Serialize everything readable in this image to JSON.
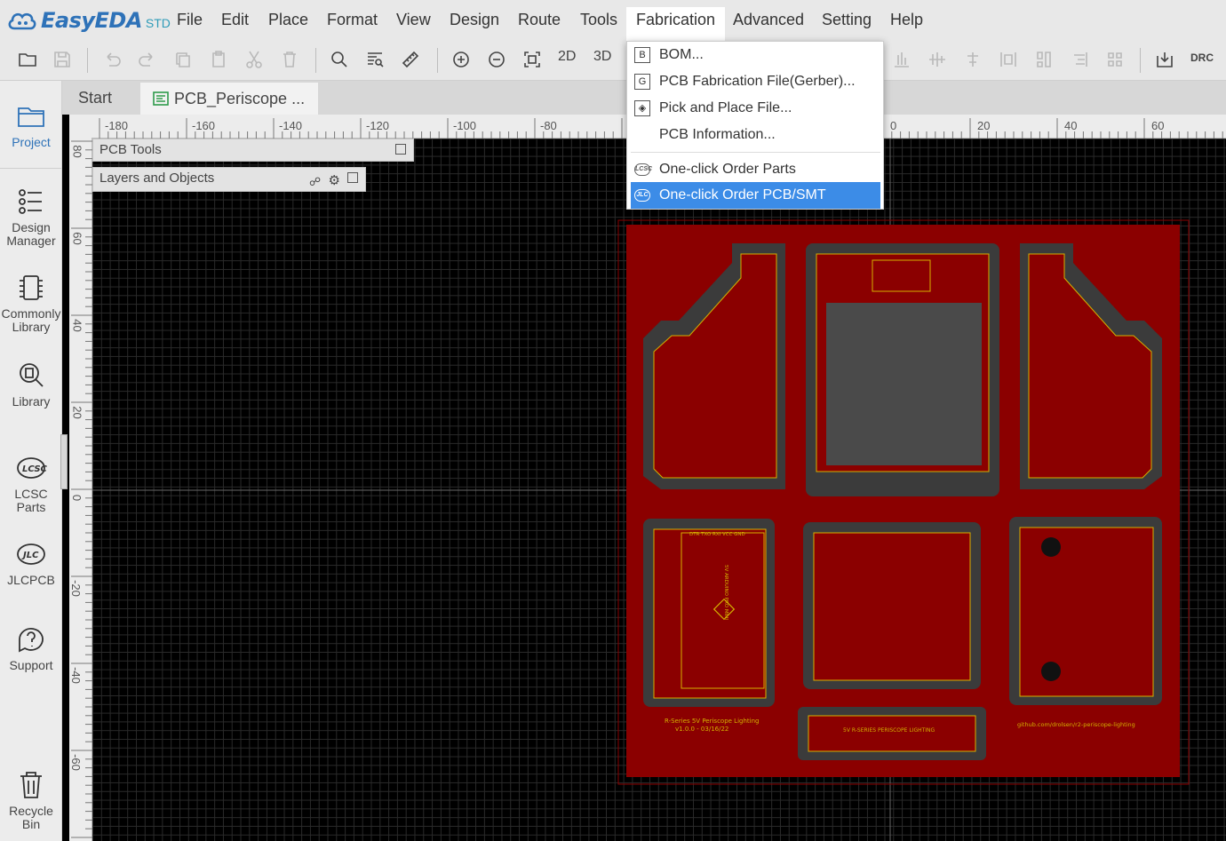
{
  "app": {
    "brand": "EasyEDA",
    "edition": "STD",
    "accent_color": "#2e72b8"
  },
  "menu": {
    "items": [
      "File",
      "Edit",
      "Place",
      "Format",
      "View",
      "Design",
      "Route",
      "Tools",
      "Fabrication",
      "Advanced",
      "Setting",
      "Help"
    ],
    "active": "Fabrication"
  },
  "toolbar": {
    "view_2d": "2D",
    "view_3d": "3D",
    "drc": "DRC"
  },
  "sidebar": {
    "items": [
      {
        "label": "Project",
        "icon": "folder-icon"
      },
      {
        "label": "Design\nManager",
        "icon": "design-manager-icon"
      },
      {
        "label": "Commonly\nLibrary",
        "icon": "chip-icon"
      },
      {
        "label": "Library",
        "icon": "library-search-icon"
      },
      {
        "label": "LCSC\nParts",
        "icon": "lcsc-logo-icon"
      },
      {
        "label": "JLCPCB",
        "icon": "jlc-logo-icon"
      },
      {
        "label": "Support",
        "icon": "help-icon"
      },
      {
        "label": "Recycle\nBin",
        "icon": "trash-icon"
      }
    ],
    "active": "Project"
  },
  "tabs": [
    {
      "label": "Start"
    },
    {
      "label": "PCB_Periscope ..."
    }
  ],
  "ruler": {
    "x_ticks": [
      "-180",
      "-160",
      "-140",
      "-120",
      "-100",
      "-80",
      "0",
      "20",
      "40",
      "60"
    ],
    "y_ticks": [
      "80",
      "60",
      "40",
      "20",
      "0",
      "-20",
      "-40",
      "-60"
    ]
  },
  "panels": {
    "pcb_tools": "PCB Tools",
    "layers": "Layers and Objects"
  },
  "fabrication_menu": {
    "items": [
      {
        "label": "BOM...",
        "icon": "B"
      },
      {
        "label": "PCB Fabrication File(Gerber)...",
        "icon": "G"
      },
      {
        "label": "Pick and Place File...",
        "icon": "pick-place-icon"
      },
      {
        "label": "PCB Information...",
        "icon": ""
      },
      {
        "label": "One-click Order Parts",
        "icon": "LCSC"
      },
      {
        "label": "One-click Order PCB/SMT",
        "icon": "JLC"
      }
    ],
    "highlighted": "One-click Order PCB/SMT",
    "highlight_color": "#3c8ce7"
  },
  "pcb": {
    "board_color": "#8b0000",
    "silk_color": "#d4b000",
    "label_left": "R-Series 5V Periscope Lighting\nv1.0.0 - 03/16/22",
    "label_right": "github.com/drolsen/r2-periscope-lighting",
    "label_center": "5V R-SERIES PERISCOPE LIGHTING",
    "pins_top": [
      "DTR",
      "TXO",
      "RXI",
      "VCC",
      "GND"
    ],
    "arduino_label": "5V ARDUINO PRO MINI"
  }
}
